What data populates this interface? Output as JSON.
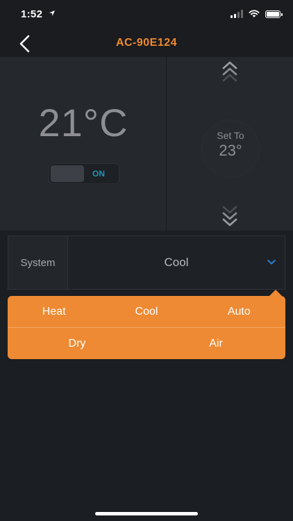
{
  "status_bar": {
    "time": "1:52"
  },
  "nav": {
    "title": "AC-90E124"
  },
  "thermostat": {
    "current_temp": "21°C",
    "power_label": "ON",
    "setpoint_label": "Set To",
    "setpoint_value": "23°"
  },
  "system": {
    "label": "System",
    "selected": "Cool"
  },
  "dropdown": {
    "row1": [
      "Heat",
      "Cool",
      "Auto"
    ],
    "row2": [
      "Dry",
      "Air"
    ]
  },
  "colors": {
    "accent": "#ef8a2e",
    "dropdown_bg": "#ee8a33",
    "toggle_on": "#1e94b8",
    "background": "#1b1e22",
    "panel": "#25282c"
  }
}
